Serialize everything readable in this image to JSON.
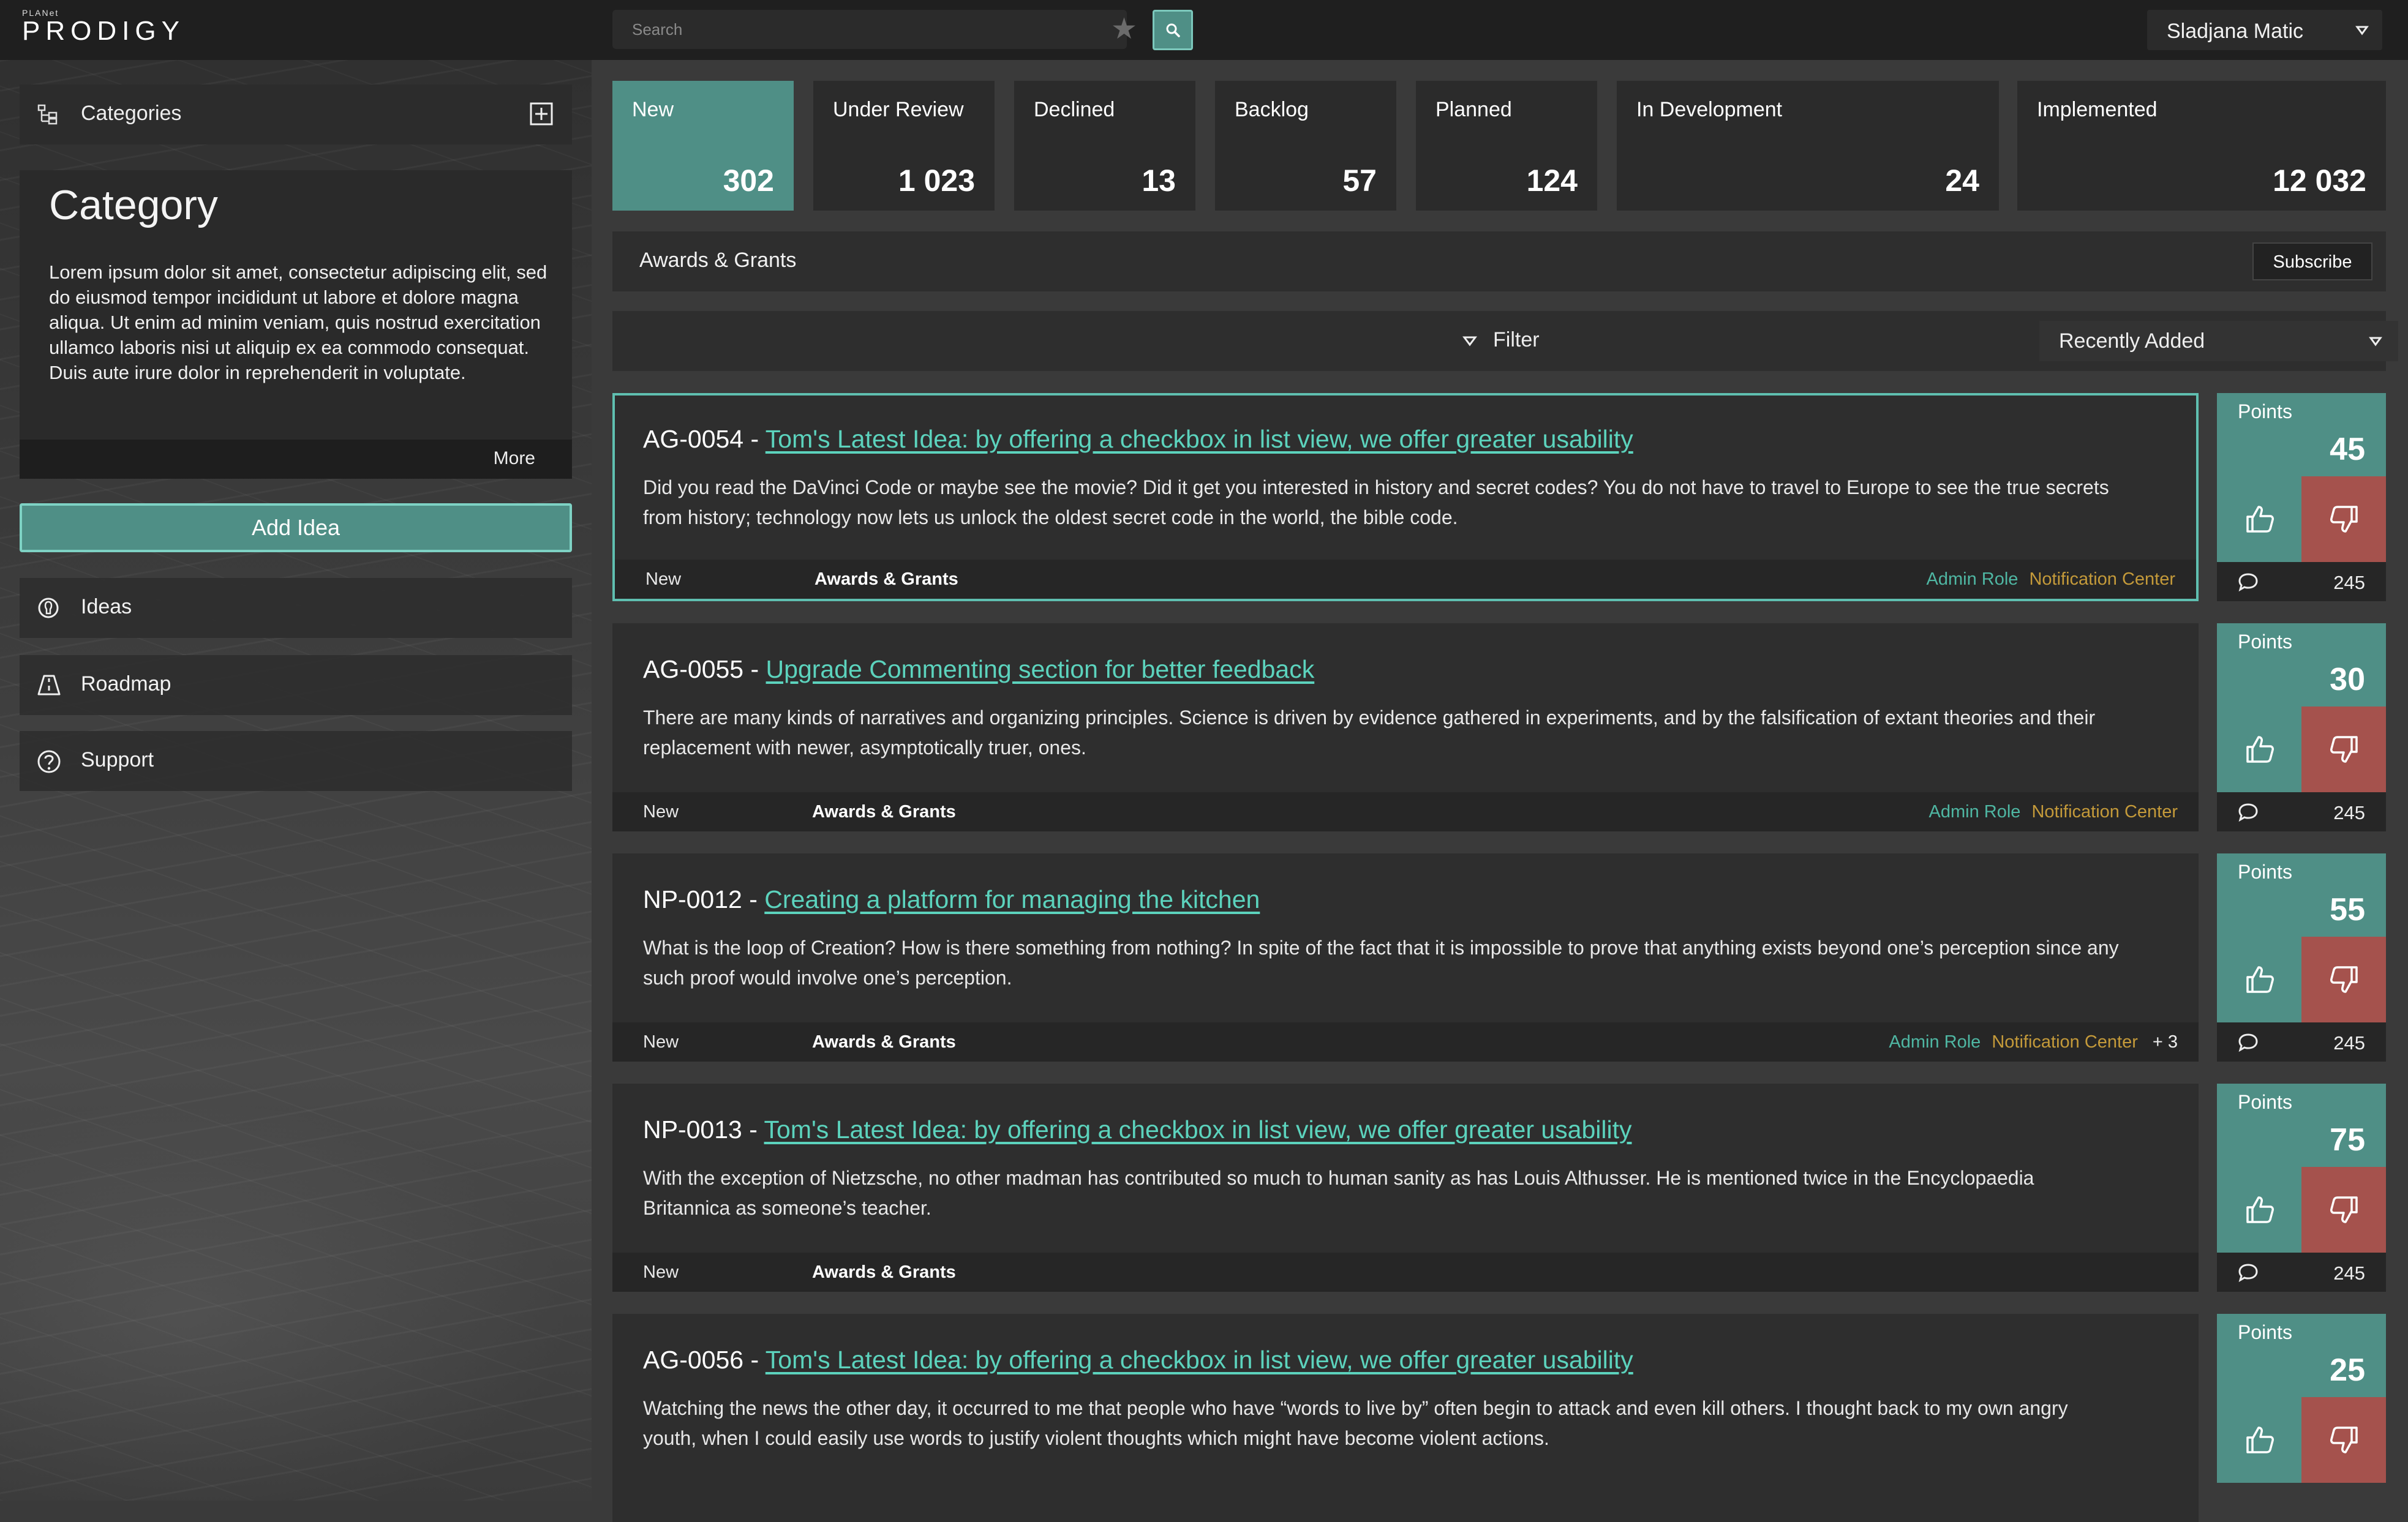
{
  "app": {
    "logo_small": "PLANet",
    "logo_big": "PRODIGY"
  },
  "search": {
    "placeholder": "Search"
  },
  "user": {
    "name": "Sladjana Matic"
  },
  "sidebar": {
    "categories_label": "Categories",
    "category_title": "Category",
    "category_description": "Lorem ipsum dolor sit amet, consectetur adipiscing elit, sed do eiusmod tempor incididunt ut labore et dolore magna aliqua. Ut enim ad minim veniam, quis nostrud exercitation ullamco laboris nisi ut aliquip ex ea commodo consequat. Duis aute irure dolor in reprehenderit in voluptate.",
    "more_label": "More",
    "add_idea_label": "Add Idea",
    "nav": [
      {
        "label": "Ideas"
      },
      {
        "label": "Roadmap"
      },
      {
        "label": "Support"
      }
    ]
  },
  "status_tiles": [
    {
      "label": "New",
      "count": "302"
    },
    {
      "label": "Under Review",
      "count": "1 023"
    },
    {
      "label": "Declined",
      "count": "13"
    },
    {
      "label": "Backlog",
      "count": "57"
    },
    {
      "label": "Planned",
      "count": "124"
    },
    {
      "label": "In Development",
      "count": "24"
    },
    {
      "label": "Implemented",
      "count": "12 032"
    }
  ],
  "category_bar": {
    "label": "Awards & Grants",
    "subscribe_label": "Subscribe"
  },
  "filter_bar": {
    "filter_label": "Filter",
    "sort_label": "Recently Added"
  },
  "ideas": [
    {
      "code": "AG-0054 - ",
      "title": "Tom's Latest Idea: by offering a checkbox in list view, we offer greater usability",
      "description": "Did you read the DaVinci Code or maybe see the movie? Did it get you interested in history and secret codes? You do not have to travel to Europe to see the true secrets from history; technology now lets us unlock the oldest secret code in the world, the bible code.",
      "status": "New",
      "category": "Awards & Grants",
      "tag_admin": "Admin Role",
      "tag_notification": "Notification Center",
      "tag_more": "",
      "points_label": "Points",
      "points": "45",
      "comments": "245"
    },
    {
      "code": "AG-0055 - ",
      "title": "Upgrade Commenting section for better feedback",
      "description": "There are many kinds of narratives and organizing principles. Science is driven by evidence gathered in experiments, and by the falsification of extant theories and their replacement with newer, asymptotically truer, ones.",
      "status": "New",
      "category": "Awards & Grants",
      "tag_admin": "Admin Role",
      "tag_notification": "Notification Center",
      "tag_more": "",
      "points_label": "Points",
      "points": "30",
      "comments": "245"
    },
    {
      "code": "NP-0012 - ",
      "title": "Creating a platform for managing the kitchen",
      "description": "What is the loop of Creation? How is there something from nothing? In spite of the fact that it is impossible to prove that anything exists beyond one’s perception since any such proof would involve one’s perception.",
      "status": "New",
      "category": "Awards & Grants",
      "tag_admin": "Admin Role",
      "tag_notification": "Notification Center",
      "tag_more": "+ 3",
      "points_label": "Points",
      "points": "55",
      "comments": "245"
    },
    {
      "code": "NP-0013 - ",
      "title": "Tom's Latest Idea: by offering a checkbox in list view, we offer greater usability",
      "description": "With the exception of Nietzsche, no other madman has contributed so much to human sanity as has Louis Althusser. He is mentioned twice in the Encyclopaedia Britannica as someone’s teacher.",
      "status": "New",
      "category": "Awards & Grants",
      "tag_admin": "",
      "tag_notification": "",
      "tag_more": "",
      "points_label": "Points",
      "points": "75",
      "comments": "245"
    },
    {
      "code": "AG-0056 - ",
      "title": "Tom's Latest Idea: by offering a checkbox in list view, we offer greater usability",
      "description": "Watching the news the other day, it occurred to me that people who have “words to live by” often begin to attack and even kill others. I thought back to my own angry youth, when I could easily use words to justify violent thoughts which might have become violent actions.",
      "status": "",
      "category": "",
      "tag_admin": "",
      "tag_notification": "",
      "tag_more": "",
      "points_label": "Points",
      "points": "25",
      "comments": ""
    }
  ],
  "colors": {
    "accent": "#4f8f86",
    "accent_border": "#7ed2c4",
    "link": "#5cd3bd",
    "downvote": "#a5524d",
    "tag_admin": "#4fb7a3",
    "tag_notification": "#c49a3a"
  },
  "icons": {
    "categories": "tree-icon",
    "add_category": "plus-square-icon",
    "ideas": "bulb-icon",
    "roadmap": "road-icon",
    "support": "help-circle-icon",
    "search": "search-icon",
    "favorite": "star-icon",
    "upvote": "thumbs-up-icon",
    "downvote": "thumbs-down-icon",
    "comments": "comment-icon",
    "filter": "triangle-down-icon"
  }
}
